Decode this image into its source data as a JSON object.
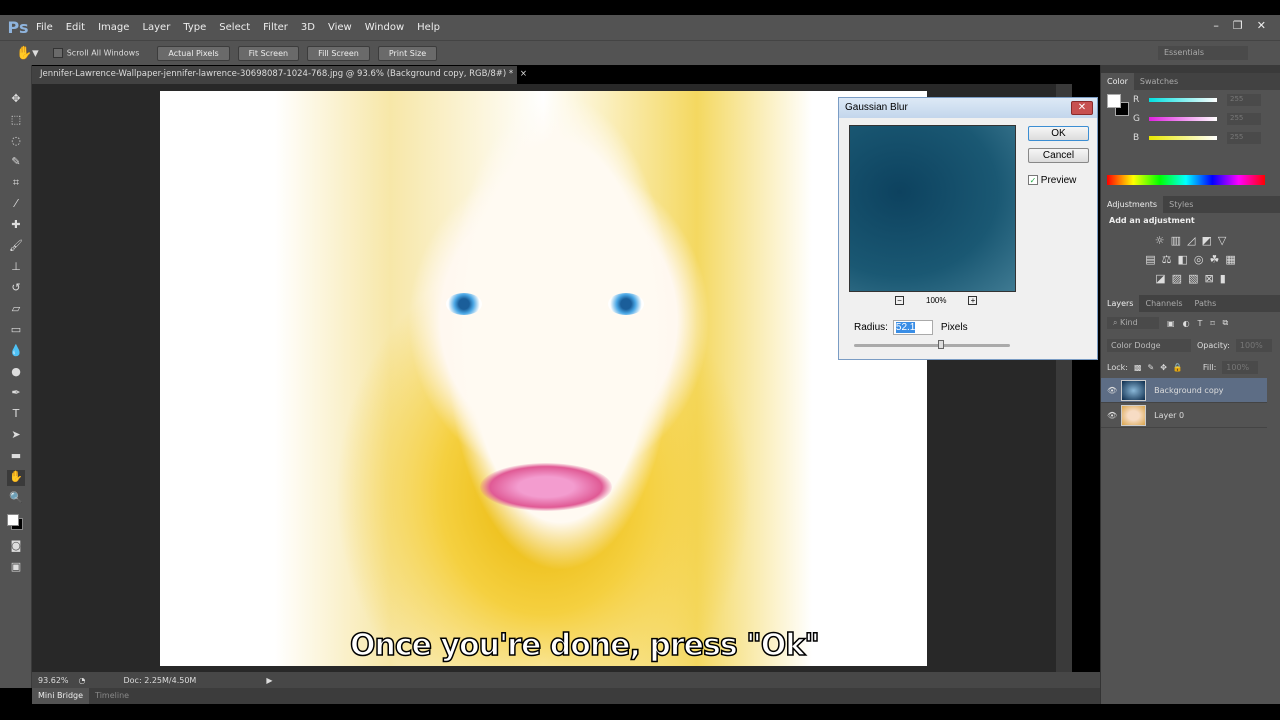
{
  "app": {
    "logo": "Ps",
    "menu": [
      "File",
      "Edit",
      "Image",
      "Layer",
      "Type",
      "Select",
      "Filter",
      "3D",
      "View",
      "Window",
      "Help"
    ],
    "window_controls": [
      "–",
      "❐",
      "✕"
    ]
  },
  "options": {
    "scroll_all": "Scroll All Windows",
    "buttons": [
      "Actual Pixels",
      "Fit Screen",
      "Fill Screen",
      "Print Size"
    ],
    "workspace": "Essentials"
  },
  "document": {
    "tab_title": "Jennifer-Lawrence-Wallpaper-jennifer-lawrence-30698087-1024-768.jpg @ 93.6% (Background copy, RGB/8#) *",
    "close": "×",
    "caption": "Once you're done, press \"Ok\""
  },
  "status": {
    "zoom": "93.62%",
    "doc": "Doc: 2.25M/4.50M",
    "tabs": [
      "Mini Bridge",
      "Timeline"
    ]
  },
  "color_panel": {
    "tabs": [
      "Color",
      "Swatches"
    ],
    "channels": [
      {
        "label": "R",
        "value": "255",
        "color": "#00e0e0"
      },
      {
        "label": "G",
        "value": "255",
        "color": "#e020e0"
      },
      {
        "label": "B",
        "value": "255",
        "color": "#e8e800"
      }
    ]
  },
  "adjustments_panel": {
    "tabs": [
      "Adjustments",
      "Styles"
    ],
    "heading": "Add an adjustment"
  },
  "layers_panel": {
    "tabs": [
      "Layers",
      "Channels",
      "Paths"
    ],
    "kind": "Kind",
    "blend_mode": "Color Dodge",
    "opacity_label": "Opacity:",
    "opacity": "100%",
    "lock_label": "Lock:",
    "fill_label": "Fill:",
    "fill": "100%",
    "layers": [
      {
        "name": "Background copy",
        "selected": true
      },
      {
        "name": "Layer 0",
        "selected": false
      }
    ]
  },
  "dialog": {
    "title": "Gaussian Blur",
    "ok": "OK",
    "cancel": "Cancel",
    "preview_label": "Preview",
    "preview_checked": true,
    "zoom": "100%",
    "radius_label": "Radius:",
    "radius": "52.1",
    "unit": "Pixels",
    "slider_fraction": 0.56
  }
}
